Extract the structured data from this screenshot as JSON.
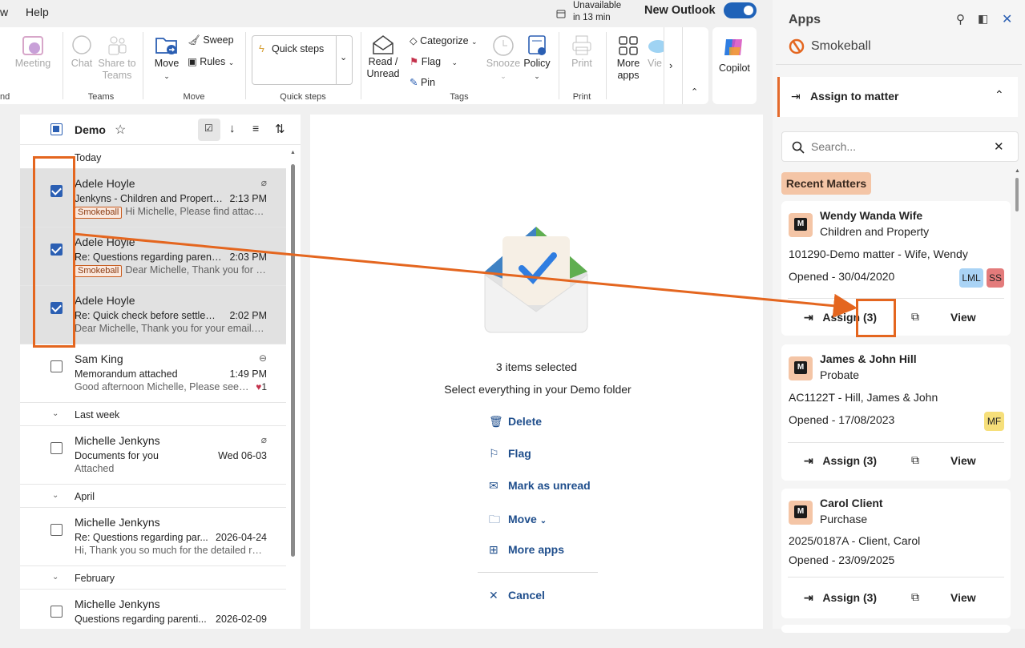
{
  "topbar": {
    "left_text": "w",
    "help": "Help",
    "status_line1": "Unavailable",
    "status_line2": "in 13 min",
    "new_outlook": "New Outlook"
  },
  "ribbon": {
    "edge": "nd",
    "meeting": "Meeting",
    "chat": "Chat",
    "share_to_teams_1": "Share to",
    "share_to_teams_2": "Teams",
    "teams_group": "Teams",
    "move": "Move",
    "sweep": "Sweep",
    "rules": "Rules",
    "move_group": "Move",
    "quick_steps": "Quick steps",
    "quick_steps_group": "Quick steps",
    "read_unread_1": "Read /",
    "read_unread_2": "Unread",
    "categorize": "Categorize",
    "flag": "Flag",
    "pin": "Pin",
    "snooze": "Snooze",
    "policy": "Policy",
    "tags_group": "Tags",
    "print": "Print",
    "print_group": "Print",
    "more_apps_1": "More",
    "more_apps_2": "apps",
    "view": "Vie",
    "copilot": "Copilot"
  },
  "list": {
    "folder": "Demo",
    "sections": {
      "today": "Today",
      "last_week": "Last week",
      "april": "April",
      "february": "February"
    },
    "messages": [
      {
        "from": "Adele Hoyle",
        "subject": "Jenkyns - Children and Property ...",
        "time": "2:13 PM",
        "tag": "Smokeball",
        "preview": "Hi Michelle, Please find attach..."
      },
      {
        "from": "Adele Hoyle",
        "subject": "Re: Questions regarding parenti...",
        "time": "2:03 PM",
        "tag": "Smokeball",
        "preview": "Dear Michelle, Thank you for y..."
      },
      {
        "from": "Adele Hoyle",
        "subject": "Re: Quick check before settleme...",
        "time": "2:02 PM",
        "tag": "",
        "preview": "Dear Michelle, Thank you for your email. I c..."
      },
      {
        "from": "Sam King",
        "subject": "Memorandum attached",
        "time": "1:49 PM",
        "tag": "",
        "preview": "Good afternoon Michelle, Please see t...",
        "reactions": "1"
      },
      {
        "from": "Michelle Jenkyns",
        "subject": "Documents for you",
        "time": "Wed 06-03",
        "tag": "",
        "preview": "Attached"
      },
      {
        "from": "Michelle Jenkyns",
        "subject": "Re: Questions regarding par...",
        "time": "2026-04-24",
        "tag": "",
        "preview": "Hi, Thank you so much for the detailed resp..."
      },
      {
        "from": "Michelle Jenkyns",
        "subject": "Questions regarding parenti...",
        "time": "2026-02-09",
        "tag": "",
        "preview": ""
      }
    ]
  },
  "reading": {
    "count": "3 items selected",
    "select_all": "Select everything in your Demo folder",
    "delete": "Delete",
    "flag": "Flag",
    "mark_unread": "Mark as unread",
    "move": "Move",
    "more_apps": "More apps",
    "cancel": "Cancel"
  },
  "apps": {
    "title": "Apps",
    "addin": "Smokeball",
    "assign_to_matter": "Assign to matter",
    "search_placeholder": "Search...",
    "recent_matters": "Recent Matters",
    "matters": [
      {
        "name": "Wendy Wanda Wife",
        "type": "Children and Property",
        "ref": "101290-Demo matter - Wife, Wendy",
        "opened": "Opened - 30/04/2020",
        "badges": [
          "LML",
          "SS"
        ],
        "assign": "Assign (3)",
        "view": "View"
      },
      {
        "name": "James & John Hill",
        "type": "Probate",
        "ref": "AC1122T - Hill, James & John",
        "opened": "Opened - 17/08/2023",
        "badges": [
          "MF"
        ],
        "assign": "Assign (3)",
        "view": "View"
      },
      {
        "name": "Carol Client",
        "type": "Purchase",
        "ref": "2025/0187A - Client, Carol",
        "opened": "Opened - 23/09/2025",
        "badges": [],
        "assign": "Assign (3)",
        "view": "View"
      }
    ]
  },
  "colors": {
    "accent": "#e4661f",
    "brand_blue": "#1f62b8",
    "badge_lml": "#a9d3f5",
    "badge_ss": "#e37b7b",
    "badge_mf": "#f6df7a"
  }
}
